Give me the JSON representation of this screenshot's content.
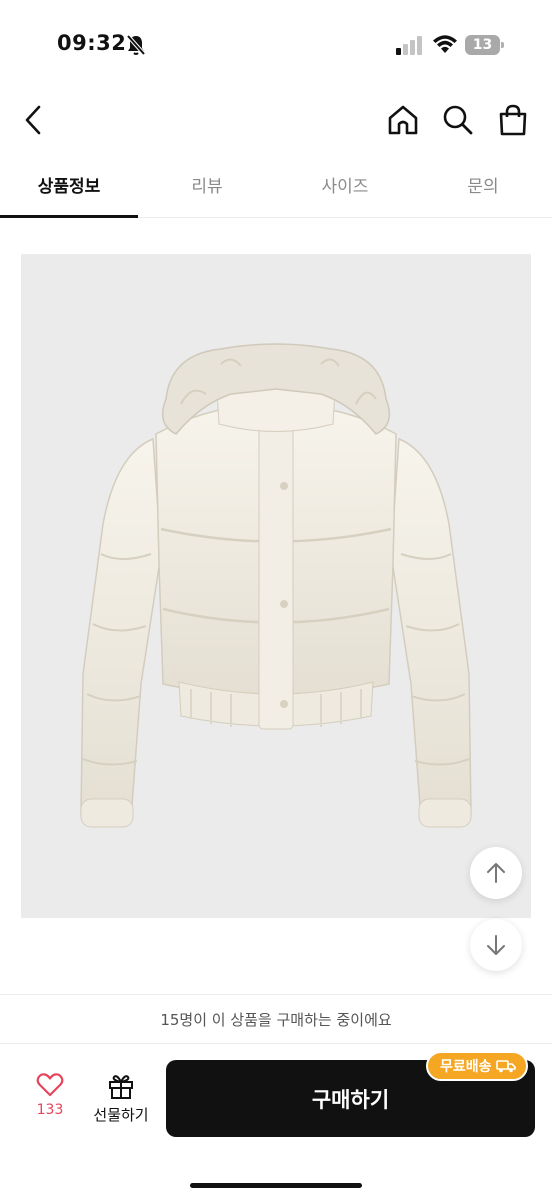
{
  "status_bar": {
    "time": "09:32",
    "battery": "13",
    "icons": [
      "bell-off-icon",
      "signal-icon",
      "wifi-icon",
      "battery-icon"
    ]
  },
  "header": {
    "icons": [
      "chevron-left-icon",
      "home-icon",
      "search-icon",
      "shopping-bag-icon"
    ]
  },
  "tabs": [
    {
      "label": "상품정보",
      "active": true
    },
    {
      "label": "리뷰",
      "active": false
    },
    {
      "label": "사이즈",
      "active": false
    },
    {
      "label": "문의",
      "active": false
    }
  ],
  "product": {
    "image": "cream-hooded-puffer-jacket"
  },
  "scroll_buttons": {
    "up_icon": "arrow-up-icon",
    "down_icon": "arrow-down-icon"
  },
  "banner": {
    "text": "15명이 이 상품을 구매하는 중이에요"
  },
  "bottom_bar": {
    "like_count": "133",
    "gift_label": "선물하기",
    "buy_label": "구매하기",
    "free_shipping_badge": "무료배송"
  },
  "colors": {
    "accent": "#f5a623",
    "heart": "#e6455b",
    "buy_button": "#111111",
    "image_bg": "#ebebeb"
  }
}
